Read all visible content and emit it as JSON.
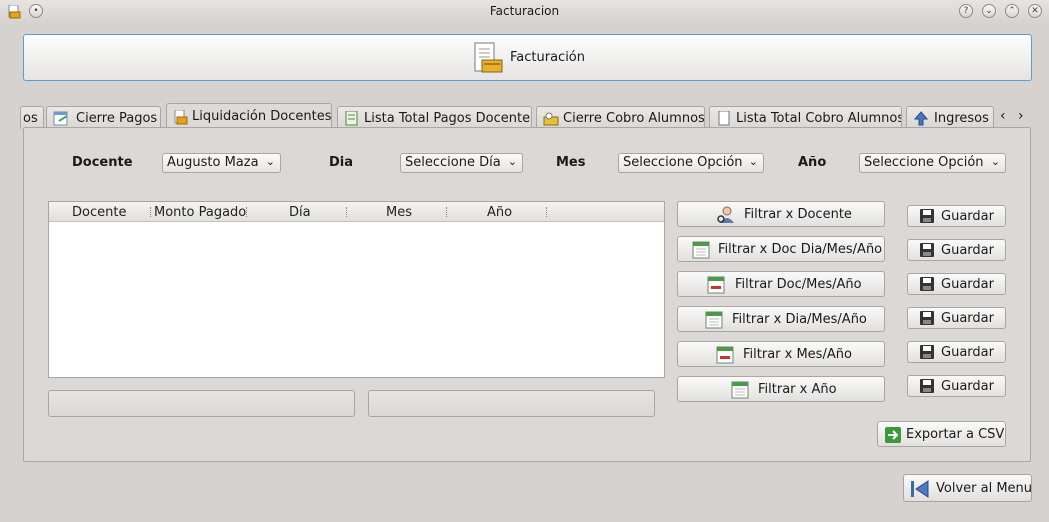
{
  "window": {
    "title": "Facturacion"
  },
  "header": {
    "label": "Facturación"
  },
  "tabs": [
    {
      "label": "os"
    },
    {
      "label": "Cierre Pagos"
    },
    {
      "label": "Liquidación Docentes"
    },
    {
      "label": "Lista Total Pagos Docente"
    },
    {
      "label": "Cierre Cobro Alumnos"
    },
    {
      "label": "Lista Total Cobro Alumnos"
    },
    {
      "label": "Ingresos"
    }
  ],
  "filters": {
    "docente_label": "Docente",
    "docente_value": "Augusto Maza",
    "dia_label": "Dia",
    "dia_value": "Seleccione Día",
    "mes_label": "Mes",
    "mes_value": "Seleccione Opción",
    "anio_label": "Año",
    "anio_value": "Seleccione Opción"
  },
  "table": {
    "columns": [
      "Docente",
      "Monto Pagado",
      "Día",
      "Mes",
      "Año"
    ],
    "rows": []
  },
  "actions": [
    {
      "label": "Filtrar x Docente",
      "save": "Guardar"
    },
    {
      "label": "Filtrar x Doc Dia/Mes/Año",
      "save": "Guardar"
    },
    {
      "label": "Filtrar Doc/Mes/Año",
      "save": "Guardar"
    },
    {
      "label": "Filtrar x Dia/Mes/Año",
      "save": "Guardar"
    },
    {
      "label": "Filtrar x Mes/Año",
      "save": "Guardar"
    },
    {
      "label": "Filtrar x Año",
      "save": "Guardar"
    }
  ],
  "export_label": "Exportar a CSV",
  "back_label": "Volver al Menu",
  "colors": {
    "accent": "#5a9fd4",
    "window_bg": "#d6d2d0"
  }
}
